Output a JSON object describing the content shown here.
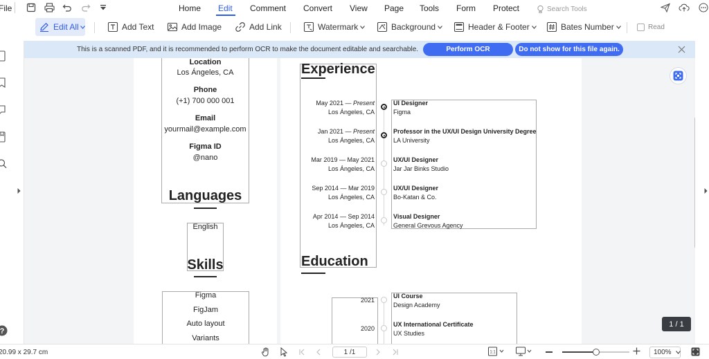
{
  "menu": {
    "file": "File",
    "tabs": [
      "Home",
      "Edit",
      "Comment",
      "Convert",
      "View",
      "Page",
      "Tools",
      "Form",
      "Protect"
    ],
    "search_placeholder": "Search Tools"
  },
  "toolbar": {
    "edit_all": "Edit All",
    "add_text": "Add Text",
    "add_image": "Add Image",
    "add_link": "Add Link",
    "watermark": "Watermark",
    "background": "Background",
    "header_footer": "Header & Footer",
    "bates_number": "Bates Number",
    "read": "Read"
  },
  "notice": {
    "message": "This is a scanned PDF, and it is recommended to perform OCR to make the document editable and searchable.",
    "perform_ocr": "Perform OCR",
    "dont_show": "Do not show for this file again."
  },
  "left_page": {
    "location_label": "Location",
    "location_value": "Los Ángeles, CA",
    "phone_label": "Phone",
    "phone_value": "(+1) 700 000 001",
    "email_label": "Email",
    "email_value": "yourmail@example.com",
    "figma_label": "Figma ID",
    "figma_value": "@nano",
    "languages_heading": "Languages",
    "languages": [
      "English"
    ],
    "skills_heading": "Skills",
    "skills": [
      "Figma",
      "FigJam",
      "Auto layout",
      "Variants"
    ]
  },
  "right_page": {
    "experience_heading": "Experience",
    "experience": [
      {
        "start": "May 2021",
        "end": "Present",
        "location": "Los Ángeles, CA",
        "title": "UI Designer",
        "org": "Figma",
        "active": true
      },
      {
        "start": "Jan 2021",
        "end": "Present",
        "location": "Los Ángeles, CA",
        "title": "Professor in the UX/UI Design University Degree",
        "org": "LA University",
        "active": true
      },
      {
        "start": "Mar 2019",
        "end": "May 2021",
        "location": "Los Ángeles, CA",
        "title": "UX/UI Designer",
        "org": "Jar Jar Binks Studio",
        "active": false
      },
      {
        "start": "Sep 2014",
        "end": "Mar 2019",
        "location": "Los Ángeles, CA",
        "title": "UX/UI Designer",
        "org": "Bo-Katan & Co.",
        "active": false
      },
      {
        "start": "Apr 2014",
        "end": "Sep 2014",
        "location": "Los Ángeles, CA",
        "title": "Visual Designer",
        "org": "General Grevous Agency",
        "active": false
      }
    ],
    "education_heading": "Education",
    "education": [
      {
        "year": "2021",
        "title": "UI Course",
        "org": "Design Academy"
      },
      {
        "year": "2020",
        "title": "UX International Certificate",
        "org": "UX Studies"
      }
    ]
  },
  "page_badge": "1 / 1",
  "status": {
    "page_size": "20.99 x 29.7 cm",
    "page_input": "1 /1",
    "zoom": "100%",
    "zoom_level": 0.5
  },
  "colors": {
    "accent": "#2f5bea",
    "notice_bg": "#dbe8f7",
    "pill_bg": "#3f6cf0"
  }
}
